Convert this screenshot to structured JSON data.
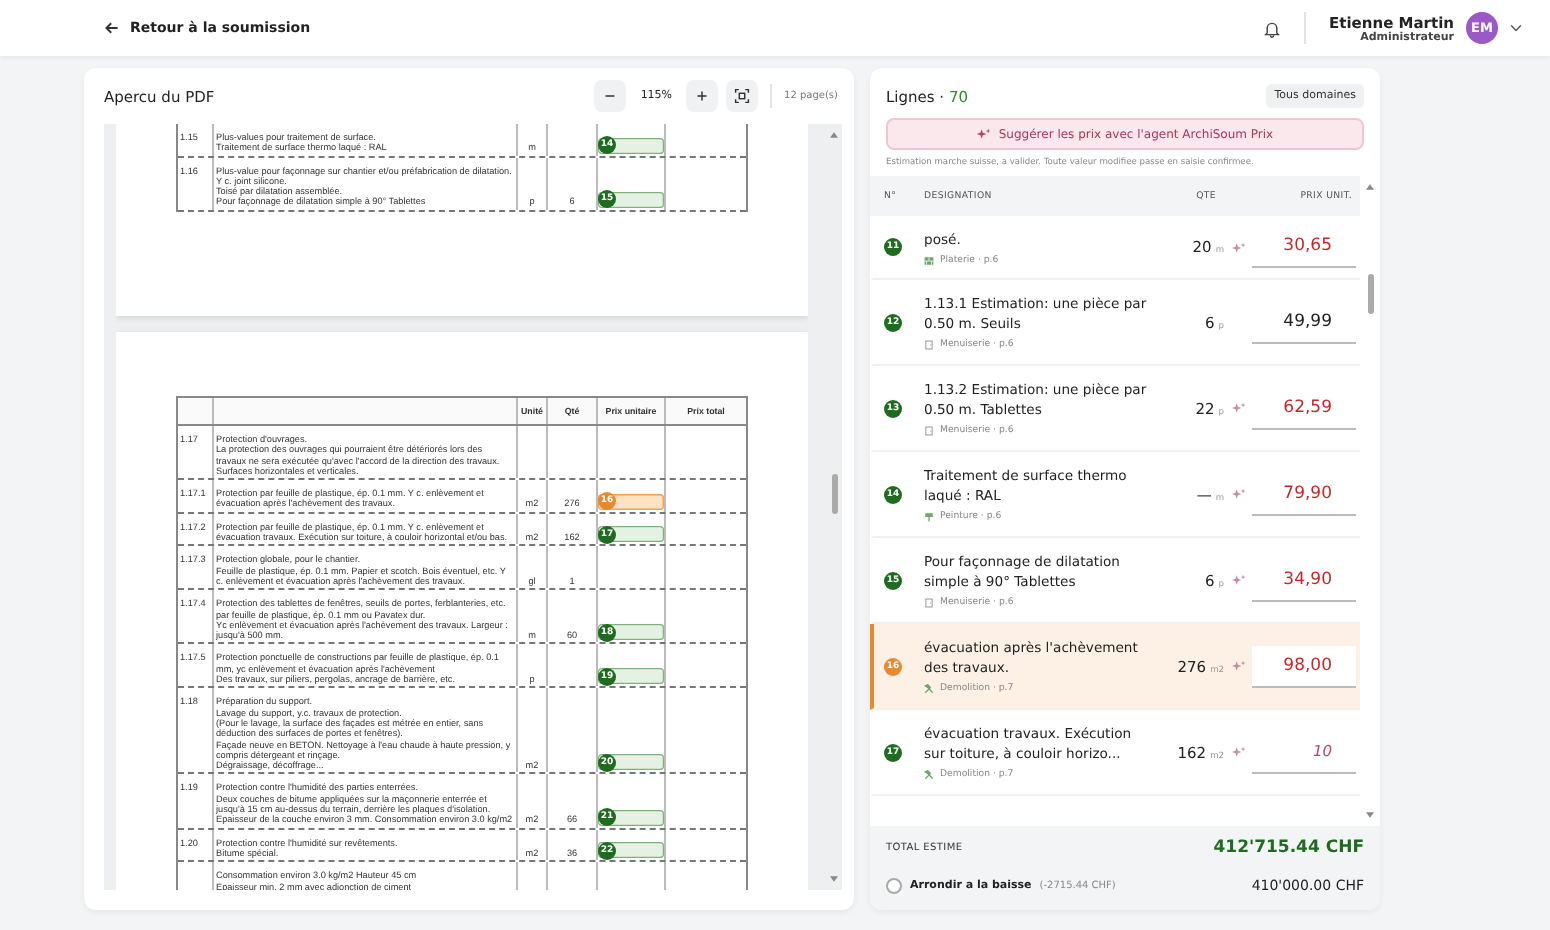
{
  "header": {
    "back_link": "Retour à la soumission",
    "user": {
      "name": "Etienne Martin",
      "role": "Administrateur",
      "initials": "EM"
    }
  },
  "pdf": {
    "title": "Apercu du PDF",
    "zoom": "115%",
    "page_count": "12 page(s)",
    "pages": [
      {
        "rows": [
          {
            "num": "1.15",
            "lines": [
              "Plus-values pour traitement de surface.",
              "Traitement de surface thermo laqué : RAL"
            ],
            "unit": "m",
            "marker": {
              "number": "14",
              "selected": false
            }
          },
          {
            "num": "1.16",
            "lines": [
              "Plus-value pour façonnage sur chantier et/ou préfabrication de dilatation. Y c. joint silicone.",
              "Toisé par dilatation assemblée.",
              "Pour façonnage de dilatation simple à 90° Tablettes"
            ],
            "unit": "p",
            "qty": "6",
            "marker": {
              "number": "15",
              "selected": false
            }
          }
        ]
      },
      {
        "columns": [
          "Unité",
          "Qté",
          "Prix unitaire",
          "Prix total"
        ],
        "rows": [
          {
            "num": "1.17",
            "lines": [
              "Protection d'ouvrages.",
              "La protection des ouvrages qui pourraient être détériorés lors des travaux ne sera exécutée qu'avec l'accord de la direction des travaux.",
              "Surfaces horizontales et verticales."
            ]
          },
          {
            "num": "1.17.1",
            "lines": [
              "Protection par feuille de plastique, ép. 0.1 mm. Y c. enlèvement et évacuation après l'achèvement des travaux."
            ],
            "unit": "m2",
            "qty": "276",
            "marker": {
              "number": "16",
              "selected": true
            }
          },
          {
            "num": "1.17.2",
            "lines": [
              "Protection par feuille de plastique, ép. 0.1 mm. Y c. enlèvement et évacuation travaux. Exécution sur toiture, à couloir horizontal et/ou bas."
            ],
            "unit": "m2",
            "qty": "162",
            "marker": {
              "number": "17",
              "selected": false
            }
          },
          {
            "num": "1.17.3",
            "lines": [
              "Protection globale, pour le chantier.",
              "Feuille de plastique, ép. 0.1 mm. Papier et scotch. Bois éventuel, etc. Y c. enlèvement et évacuation après l'achèvement des travaux."
            ],
            "unit": "gl",
            "qty": "1"
          },
          {
            "num": "1.17.4",
            "lines": [
              "Protection des tablettes de fenêtres, seuils de portes, ferblanteries, etc. par feuille de plastique, ép. 0.1 mm ou Pavatex dur.",
              "Yc enlèvement et évacuation après l'achèvement des travaux. Largeur : jusqu'à 500 mm."
            ],
            "unit": "m",
            "qty": "60",
            "marker": {
              "number": "18",
              "selected": false
            }
          },
          {
            "num": "1.17.5",
            "lines": [
              "Protection ponctuelle de constructions par feuille de plastique, ép. 0.1 mm, yc enlèvement et évacuation après l'achèvement",
              "Des travaux, sur piliers, pergolas, ancrage de barrière, etc."
            ],
            "unit": "p",
            "marker": {
              "number": "19",
              "selected": false
            }
          },
          {
            "num": "1.18",
            "lines": [
              "Préparation du support.",
              "Lavage du support, y.c. travaux de protection.",
              "(Pour le lavage, la surface des façades est métrée en entier, sans déduction des surfaces de portes et fenêtres).",
              "Façade neuve en BETON. Nettoyage à l'eau chaude à haute pression, y compris détergeant et rinçage.",
              "Dégraissage, décoffrage..."
            ],
            "unit": "m2",
            "marker": {
              "number": "20",
              "selected": false
            }
          },
          {
            "num": "1.19",
            "lines": [
              "Protection contre l'humidité des parties enterrées.",
              "Deux couches de bitume appliquées sur la maçonnerie enterrée et jusqu'à 15 cm au-dessus du terrain, derrière les plaques d'isolation.",
              "Epaisseur de la couche environ 3 mm. Consommation environ 3.0 kg/m2"
            ],
            "unit": "m2",
            "qty": "66",
            "marker": {
              "number": "21",
              "selected": false
            }
          },
          {
            "num": "1.20",
            "lines": [
              "Protection contre l'humidité sur revêtements.",
              "Bitume spécial."
            ],
            "unit": "m2",
            "qty": "36",
            "marker": {
              "number": "22",
              "selected": false
            }
          },
          {
            "lines": [
              "Consommation environ 3.0 kg/m2 Hauteur 45 cm",
              "Epaisseur min. 2 mm avec adjonction de ciment"
            ]
          }
        ]
      }
    ]
  },
  "lines": {
    "title": "Lignes ·",
    "count": "70",
    "filter": "Tous domaines",
    "suggest_button": "Suggérer les prix avec l'agent ArchiSoum Prix",
    "hint": "Estimation marche suisse, a valider. Toute valeur modifiee passe en saisie confirmee.",
    "columns": [
      "N°",
      "DESIGNATION",
      "QTE",
      "PRIX UNIT."
    ],
    "rows": [
      {
        "number": "11",
        "selected": false,
        "designation": "posé.",
        "kind": "plaster",
        "meta": "Platerie · p.6",
        "qty": "20",
        "unit": "m",
        "price": "30,65",
        "suggested": true,
        "draft": false
      },
      {
        "number": "12",
        "selected": false,
        "designation": "1.13.1 Estimation: une pièce par 0.50 m. Seuils",
        "kind": "carpentry",
        "meta": "Menuiserie · p.6",
        "qty": "6",
        "unit": "p",
        "price": "49,99",
        "suggested": false,
        "draft": false
      },
      {
        "number": "13",
        "selected": false,
        "designation": "1.13.2 Estimation: une pièce par 0.50 m. Tablettes",
        "kind": "carpentry",
        "meta": "Menuiserie · p.6",
        "qty": "22",
        "unit": "p",
        "price": "62,59",
        "suggested": true,
        "draft": false
      },
      {
        "number": "14",
        "selected": false,
        "designation": "Traitement de surface thermo laqué : RAL",
        "kind": "paint",
        "meta": "Peinture · p.6",
        "qty": "—",
        "unit": "m",
        "price": "79,90",
        "suggested": true,
        "draft": false
      },
      {
        "number": "15",
        "selected": false,
        "designation": "Pour façonnage de dilatation simple à 90° Tablettes",
        "kind": "carpentry",
        "meta": "Menuiserie · p.6",
        "qty": "6",
        "unit": "p",
        "price": "34,90",
        "suggested": true,
        "draft": false
      },
      {
        "number": "16",
        "selected": true,
        "designation": "évacuation après l'achèvement des travaux.",
        "kind": "demolition",
        "meta": "Demolition · p.7",
        "qty": "276",
        "unit": "m2",
        "price": "98,00",
        "suggested": true,
        "draft": false
      },
      {
        "number": "17",
        "selected": false,
        "designation": "évacuation travaux. Exécution sur toiture, à couloir horizo...",
        "kind": "demolition",
        "meta": "Demolition · p.7",
        "qty": "162",
        "unit": "m2",
        "price": "10",
        "suggested": true,
        "draft": true
      }
    ],
    "total": {
      "label": "TOTAL ESTIME",
      "value": "412'715.44 CHF"
    },
    "rounding": {
      "label": "Arrondir a la baisse",
      "delta": "(-2715.44 CHF)",
      "value": "410'000.00 CHF",
      "checked": false
    }
  }
}
